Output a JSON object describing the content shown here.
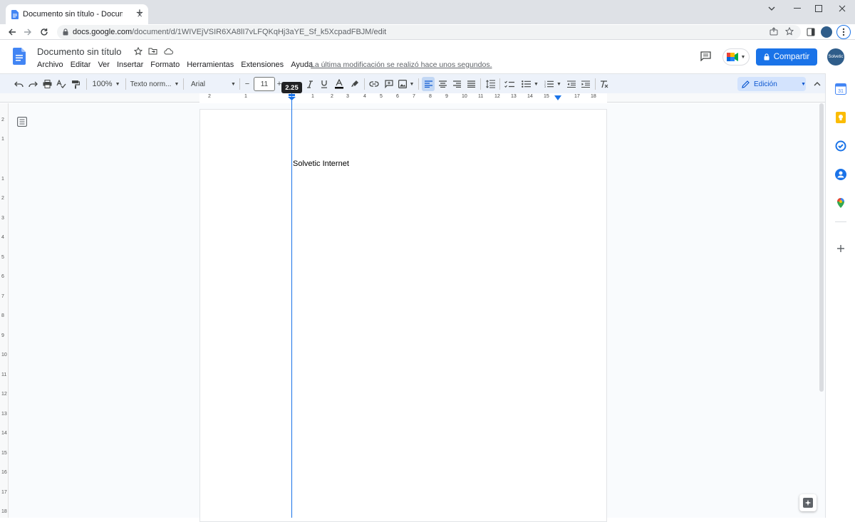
{
  "browser": {
    "tab_title": "Documento sin título - Documen",
    "url_domain": "docs.google.com",
    "url_path": "/document/d/1WIVEjVSIR6XA8lI7vLFQKqHj3aYE_Sf_k5XcpadFBJM/edit",
    "new_tab_glyph": "+",
    "tab_close_glyph": "×"
  },
  "docs": {
    "title": "Documento sin título",
    "menus": [
      "Archivo",
      "Editar",
      "Ver",
      "Insertar",
      "Formato",
      "Herramientas",
      "Extensiones",
      "Ayuda"
    ],
    "last_modified": "La última modificación se realizó hace unos segundos.",
    "share_label": "Compartir",
    "avatar_text": "Solvetic"
  },
  "toolbar": {
    "zoom": "100%",
    "style": "Texto norm...",
    "font": "Arial",
    "font_size": "11",
    "minus": "−",
    "plus": "+",
    "editing_mode": "Edición"
  },
  "ruler": {
    "tooltip": "2.25",
    "numbers": [
      "2",
      "1",
      "",
      "1",
      "2",
      "3",
      "4",
      "5",
      "6",
      "7",
      "8",
      "9",
      "10",
      "11",
      "12",
      "13",
      "14",
      "15",
      "16",
      "17",
      "18"
    ],
    "vertical_numbers": [
      "2",
      "1",
      "",
      "1",
      "2",
      "3",
      "4",
      "5",
      "6",
      "7",
      "8",
      "9",
      "10",
      "11",
      "12",
      "13",
      "14",
      "15",
      "16",
      "17",
      "18"
    ]
  },
  "document": {
    "body_text": "Solvetic Internet"
  },
  "colors": {
    "accent": "#1a73e8",
    "toolbar_bg": "#edf2fa",
    "editing_chip": "#d3e3fd"
  }
}
